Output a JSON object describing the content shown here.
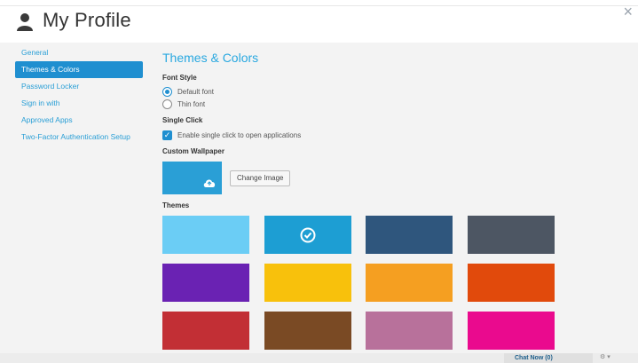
{
  "window": {
    "title": "My Profile",
    "close_glyph": "×"
  },
  "sidebar": {
    "items": [
      {
        "label": "General",
        "active": false
      },
      {
        "label": "Themes & Colors",
        "active": true
      },
      {
        "label": "Password Locker",
        "active": false
      },
      {
        "label": "Sign in with",
        "active": false
      },
      {
        "label": "Approved Apps",
        "active": false
      },
      {
        "label": "Two-Factor Authentication Setup",
        "active": false
      }
    ]
  },
  "main": {
    "title": "Themes & Colors",
    "font_style": {
      "label": "Font Style",
      "options": [
        {
          "label": "Default font",
          "selected": true
        },
        {
          "label": "Thin font",
          "selected": false
        }
      ]
    },
    "single_click": {
      "label": "Single Click",
      "checkbox_label": "Enable single click to open applications",
      "checked": true
    },
    "wallpaper": {
      "label": "Custom Wallpaper",
      "change_button": "Change Image",
      "color": "#2a9fd6"
    },
    "themes": {
      "label": "Themes",
      "selected_index": 1,
      "colors": [
        "#6bcdf5",
        "#1d9ed3",
        "#2f567d",
        "#4d5663",
        "#6a22b3",
        "#f8c10c",
        "#f59f21",
        "#e14a0c",
        "#c22f35",
        "#7a4a24",
        "#b8719b",
        "#ea0a8e"
      ]
    }
  },
  "statusbar": {
    "chat_label": "Chat Now (0)"
  },
  "colors": {
    "accent": "#1f8fd0",
    "link": "#2a9fd6"
  },
  "icons": {
    "title": "user-icon",
    "wallpaper": "cloud-upload-icon",
    "selected_theme": "check-circle-icon"
  }
}
